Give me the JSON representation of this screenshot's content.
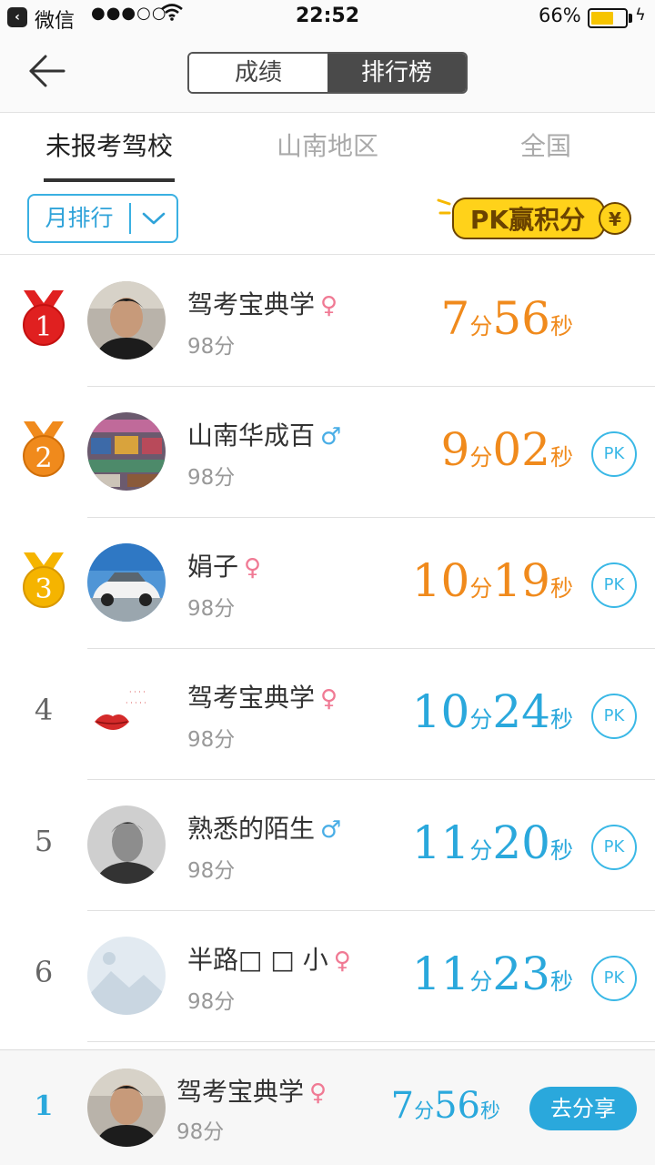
{
  "status_bar": {
    "back_glyph": "‹",
    "carrier": "微信",
    "signal": "●●●○○",
    "time": "22:52",
    "battery": "66%",
    "battery_level": 0.66
  },
  "nav": {
    "segments": [
      "成绩",
      "排行榜"
    ],
    "active_segment": 1
  },
  "tabs": [
    {
      "label": "未报考驾校",
      "active": true
    },
    {
      "label": "山南地区",
      "active": false
    },
    {
      "label": "全国",
      "active": false
    }
  ],
  "filter": {
    "period": "月排行",
    "pk_banner": "PK赢积分",
    "pk_banner_symbol": "¥"
  },
  "colors": {
    "accent": "#2aa8dc",
    "orange": "#f08a1c",
    "medal_gold": "#f5b400",
    "medal_silver": "#f08a1c",
    "medal_red": "#e02020",
    "female": "#f07a94",
    "male": "#4aaee6"
  },
  "ranking": [
    {
      "rank": "1",
      "medal": "gold-red",
      "name": "驾考宝典学",
      "gender": "female",
      "gender_icon": "♀",
      "score": "98分",
      "min": "7",
      "sec": "56",
      "min_unit": "分",
      "sec_unit": "秒",
      "color": "orange",
      "pk": false,
      "avatar": "avatar-photo-man"
    },
    {
      "rank": "2",
      "medal": "orange",
      "name": "山南华成百",
      "gender": "male",
      "gender_icon": "♂",
      "score": "98分",
      "min": "9",
      "sec": "02",
      "min_unit": "分",
      "sec_unit": "秒",
      "color": "orange",
      "pk": true,
      "avatar": "avatar-photo-shop"
    },
    {
      "rank": "3",
      "medal": "yellow",
      "name": "娟子",
      "gender": "female",
      "gender_icon": "♀",
      "score": "98分",
      "min": "10",
      "sec": "19",
      "min_unit": "分",
      "sec_unit": "秒",
      "color": "orange",
      "pk": true,
      "avatar": "avatar-photo-car"
    },
    {
      "rank": "4",
      "medal": null,
      "name": "驾考宝典学",
      "gender": "female",
      "gender_icon": "♀",
      "score": "98分",
      "min": "10",
      "sec": "24",
      "min_unit": "分",
      "sec_unit": "秒",
      "color": "blue",
      "pk": true,
      "avatar": "avatar-lips"
    },
    {
      "rank": "5",
      "medal": null,
      "name": "熟悉的陌生",
      "gender": "male",
      "gender_icon": "♂",
      "score": "98分",
      "min": "11",
      "sec": "20",
      "min_unit": "分",
      "sec_unit": "秒",
      "color": "blue",
      "pk": true,
      "avatar": "avatar-photo-bw"
    },
    {
      "rank": "6",
      "medal": null,
      "name": "半路□ □ 小",
      "gender": "female",
      "gender_icon": "♀",
      "score": "98分",
      "min": "11",
      "sec": "23",
      "min_unit": "分",
      "sec_unit": "秒",
      "color": "blue",
      "pk": true,
      "avatar": "avatar-placeholder"
    }
  ],
  "pk_label": "PK",
  "footer": {
    "rank": "1",
    "name": "驾考宝典学",
    "gender_icon": "♀",
    "score": "98分",
    "min": "7",
    "sec": "56",
    "min_unit": "分",
    "sec_unit": "秒",
    "share_label": "去分享"
  }
}
